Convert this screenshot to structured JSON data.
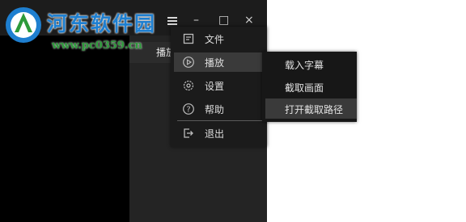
{
  "watermark": {
    "title": "河东软件园",
    "url": "www.pc0359.cn"
  },
  "sidebar_label": "播放",
  "window_controls": {
    "minimize": "–",
    "maximize": "□",
    "close": "×"
  },
  "menu": [
    {
      "label": "文件",
      "icon": "file-icon"
    },
    {
      "label": "播放",
      "icon": "play-icon",
      "active": true
    },
    {
      "label": "设置",
      "icon": "gear-icon"
    },
    {
      "label": "帮助",
      "icon": "help-icon"
    },
    {
      "label": "退出",
      "icon": "exit-icon"
    }
  ],
  "submenu": [
    {
      "label": "载入字幕"
    },
    {
      "label": "截取画面"
    },
    {
      "label": "打开截取路径",
      "active": true
    }
  ]
}
